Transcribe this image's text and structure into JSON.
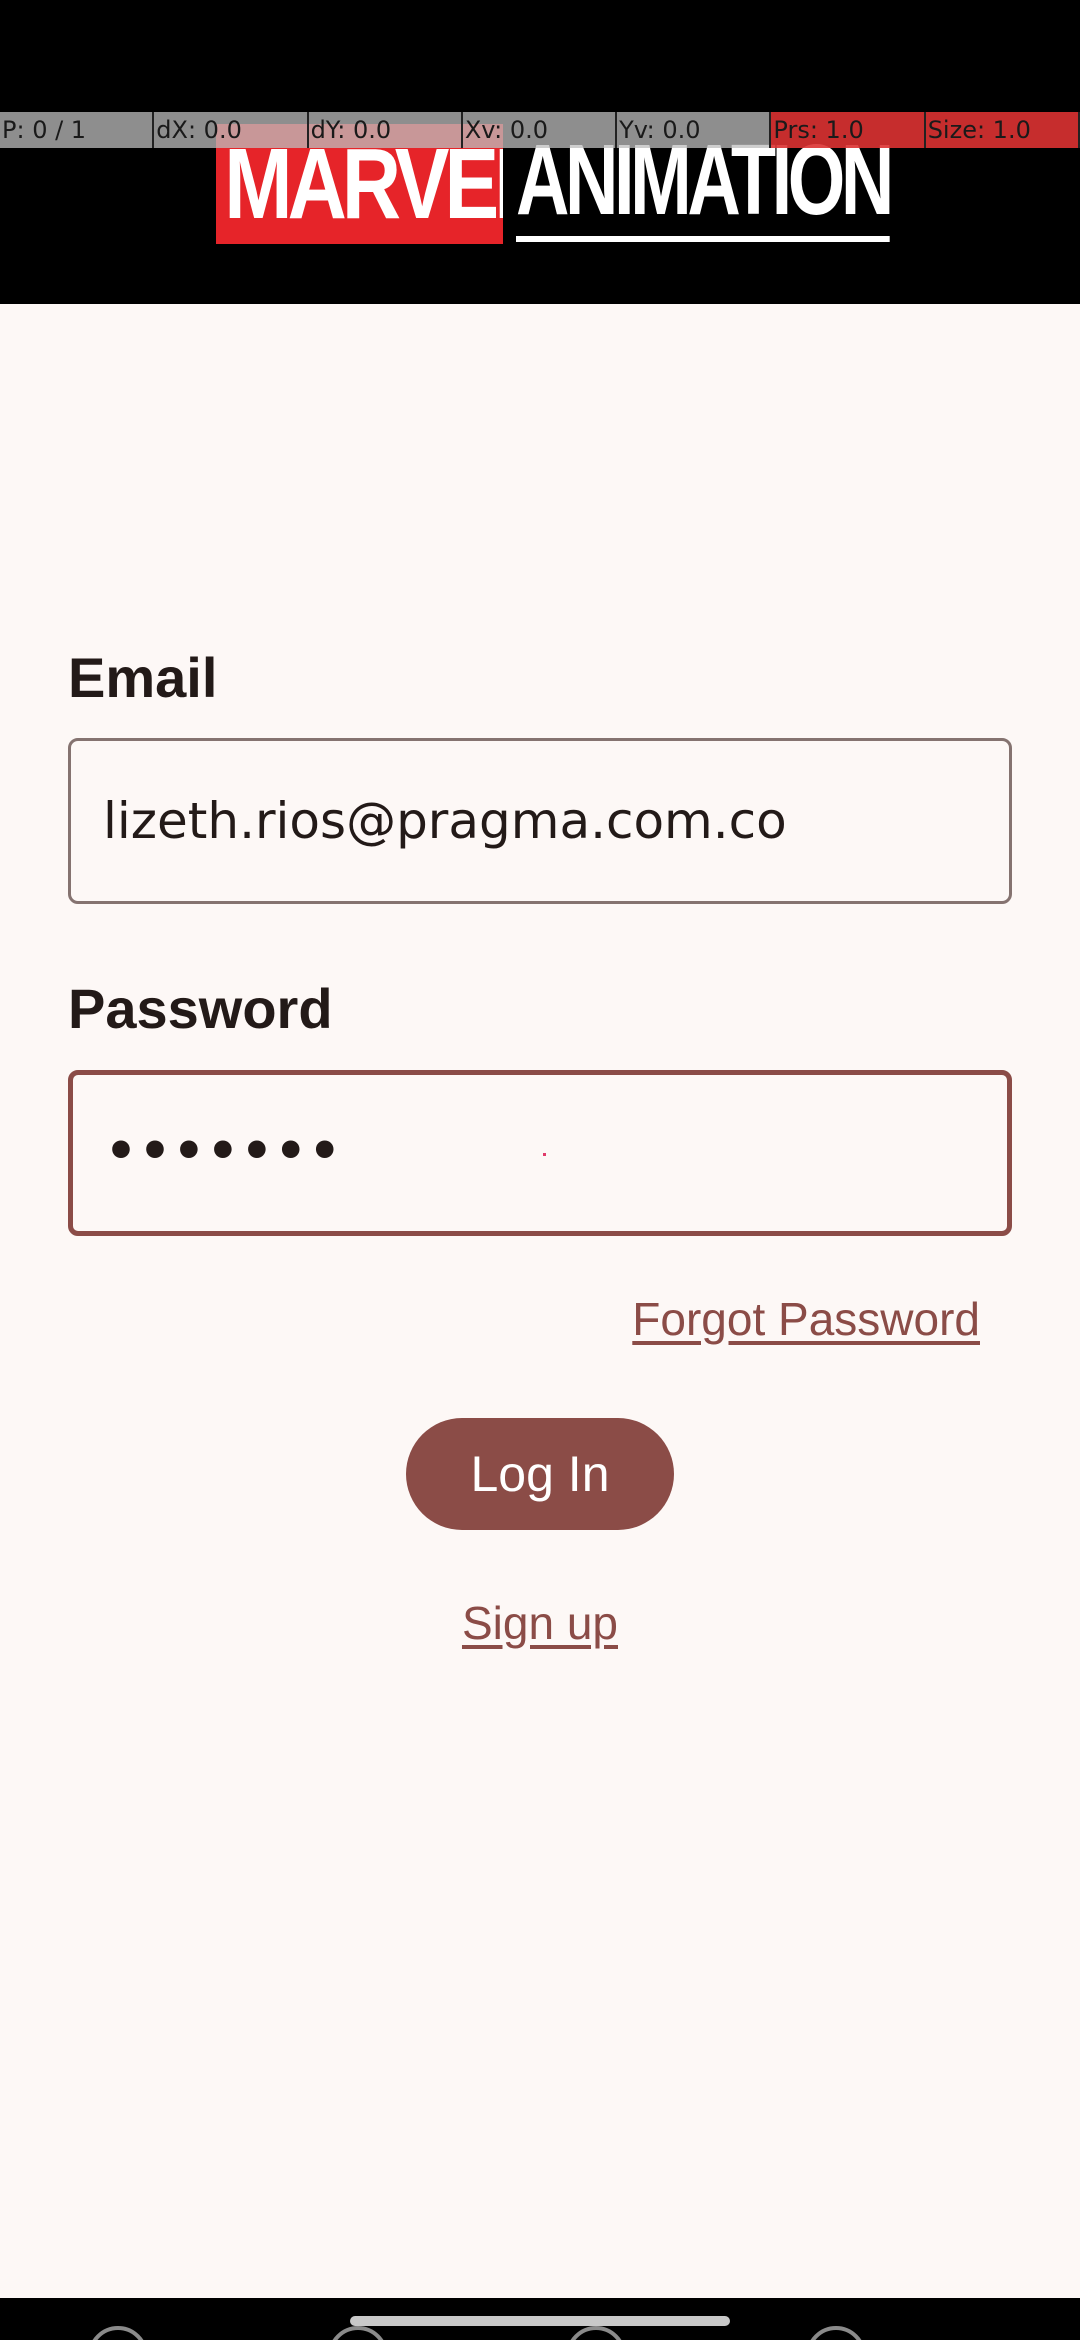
{
  "header": {
    "logo_marvel": "MARVEL",
    "logo_animation": "ANIMATION",
    "brand_color": "#e62429"
  },
  "debug_overlay": [
    {
      "text": "P: 0 / 1"
    },
    {
      "text": "dX: 0.0"
    },
    {
      "text": "dY: 0.0"
    },
    {
      "text": "Xv: 0.0"
    },
    {
      "text": "Yv: 0.0"
    },
    {
      "text": "Prs: 1.0"
    },
    {
      "text": "Size: 1.0"
    }
  ],
  "form": {
    "email_label": "Email",
    "email_value": "lizeth.rios@pragma.com.co",
    "password_label": "Password",
    "password_value": "•••••••",
    "forgot_password": "Forgot Password",
    "login_button": "Log In",
    "signup_link": "Sign up"
  },
  "colors": {
    "accent": "#8b4c47",
    "background": "#fdf8f6",
    "text": "#231a18",
    "outline": "#857370"
  }
}
